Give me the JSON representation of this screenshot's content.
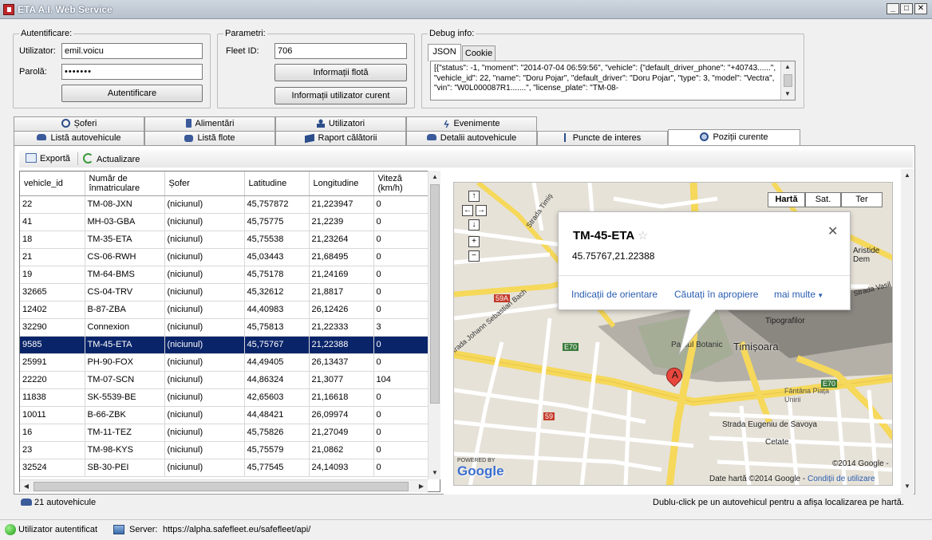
{
  "window": {
    "title": "ETA A.I. Web Service",
    "controls": {
      "minimize": "_",
      "maximize": "□",
      "close": "✕"
    }
  },
  "auth": {
    "group_label": "Autentificare:",
    "user_label": "Utilizator:",
    "user_value": "emil.voicu",
    "pass_label": "Parolă:",
    "pass_value": "•••••••",
    "button": "Autentificare"
  },
  "params": {
    "group_label": "Parametri:",
    "fleet_label": "Fleet ID:",
    "fleet_value": "706",
    "fleet_info_button": "Informații flotă",
    "user_info_button": "Informații utilizator curent"
  },
  "debug": {
    "group_label": "Debug info:",
    "tabs": [
      "JSON",
      "Cookie"
    ],
    "text": "[{\"status\": -1, \"moment\": \"2014-07-04 06:59:56\", \"vehicle\": {\"default_driver_phone\": \"+40743......\", \"vehicle_id\": 22, \"name\": \"Doru Pojar\", \"default_driver\": \"Doru Pojar\", \"type\": 3, \"model\": \"Vectra\", \"vin\": \"W0L000087R1.......\", \"license_plate\": \"TM-08-"
  },
  "tabs_row1": [
    "Șoferi",
    "Alimentări",
    "Utilizatori",
    "Evenimente"
  ],
  "tabs_row2": [
    "Listă autovehicule",
    "Listă flote",
    "Raport călătorii",
    "Detalii autovehicule",
    "Puncte de interes",
    "Poziții curente"
  ],
  "toolbar": {
    "export": "Exportă",
    "refresh": "Actualizare"
  },
  "grid": {
    "columns": [
      "vehicle_id",
      "Număr de înmatriculare",
      "Șofer",
      "Latitudine",
      "Longitudine",
      "Viteză (km/h)"
    ],
    "rows": [
      [
        "22",
        "TM-08-JXN",
        "(niciunul)",
        "45,757872",
        "21,223947",
        "0"
      ],
      [
        "41",
        "MH-03-GBA",
        "(niciunul)",
        "45,75775",
        "21,2239",
        "0"
      ],
      [
        "18",
        "TM-35-ETA",
        "(niciunul)",
        "45,75538",
        "21,23264",
        "0"
      ],
      [
        "21",
        "CS-06-RWH",
        "(niciunul)",
        "45,03443",
        "21,68495",
        "0"
      ],
      [
        "19",
        "TM-64-BMS",
        "(niciunul)",
        "45,75178",
        "21,24169",
        "0"
      ],
      [
        "32665",
        "CS-04-TRV",
        "(niciunul)",
        "45,32612",
        "21,8817",
        "0"
      ],
      [
        "12402",
        "B-87-ZBA",
        "(niciunul)",
        "44,40983",
        "26,12426",
        "0"
      ],
      [
        "32290",
        "Connexion",
        "(niciunul)",
        "45,75813",
        "21,22333",
        "3"
      ],
      [
        "9585",
        "TM-45-ETA",
        "(niciunul)",
        "45,75767",
        "21,22388",
        "0"
      ],
      [
        "25991",
        "PH-90-FOX",
        "(niciunul)",
        "44,49405",
        "26,13437",
        "0"
      ],
      [
        "22220",
        "TM-07-SCN",
        "(niciunul)",
        "44,86324",
        "21,3077",
        "104"
      ],
      [
        "11838",
        "SK-5539-BE",
        "(niciunul)",
        "42,65603",
        "21,16618",
        "0"
      ],
      [
        "10011",
        "B-66-ZBK",
        "(niciunul)",
        "44,48421",
        "26,09974",
        "0"
      ],
      [
        "16",
        "TM-11-TEZ",
        "(niciunul)",
        "45,75826",
        "21,27049",
        "0"
      ],
      [
        "23",
        "TM-98-KYS",
        "(niciunul)",
        "45,75579",
        "21,0862",
        "0"
      ],
      [
        "32524",
        "SB-30-PEI",
        "(niciunul)",
        "45,77545",
        "24,14093",
        "0"
      ]
    ],
    "selected_index": 8
  },
  "map": {
    "type_buttons": [
      "Hartă",
      "Sat.",
      "Ter"
    ],
    "popup": {
      "title": "TM-45-ETA",
      "coords": "45.75767,21.22388",
      "links": [
        "Indicații de orientare",
        "Căutați în apropiere",
        "mai multe"
      ]
    },
    "marker_label": "A",
    "labels": {
      "city": "Timișoara",
      "park": "Parcul Botanic",
      "tipografilor": "Tipografilor",
      "aristide": "Aristide Dem",
      "vasile": "Strada Vasil",
      "timis": "Strada Timiș",
      "bach": "Strada Johann Sebastian Bach",
      "eugeniu": "Strada Eugeniu de Savoya",
      "cetate": "Cetate",
      "fantana": "Fântâna Piața Unirii",
      "e70a": "E70",
      "e70b": "E70",
      "r59a": "59A",
      "r59": "59",
      "powered": "POWERED BY",
      "google": "Google",
      "copyright": "©2014 Google -",
      "data": "Date hartă ©2014 Google",
      "terms": "Condiții de utilizare"
    }
  },
  "footer": {
    "vehicle_count": "21 autovehicule",
    "hint": "Dublu-click pe un autovehicul pentru a afișa localizarea pe hartă."
  },
  "status": {
    "auth_status": "Utilizator autentificat",
    "server_label": "Server:",
    "server_url": "https://alpha.safefleet.eu/safefleet/api/"
  }
}
